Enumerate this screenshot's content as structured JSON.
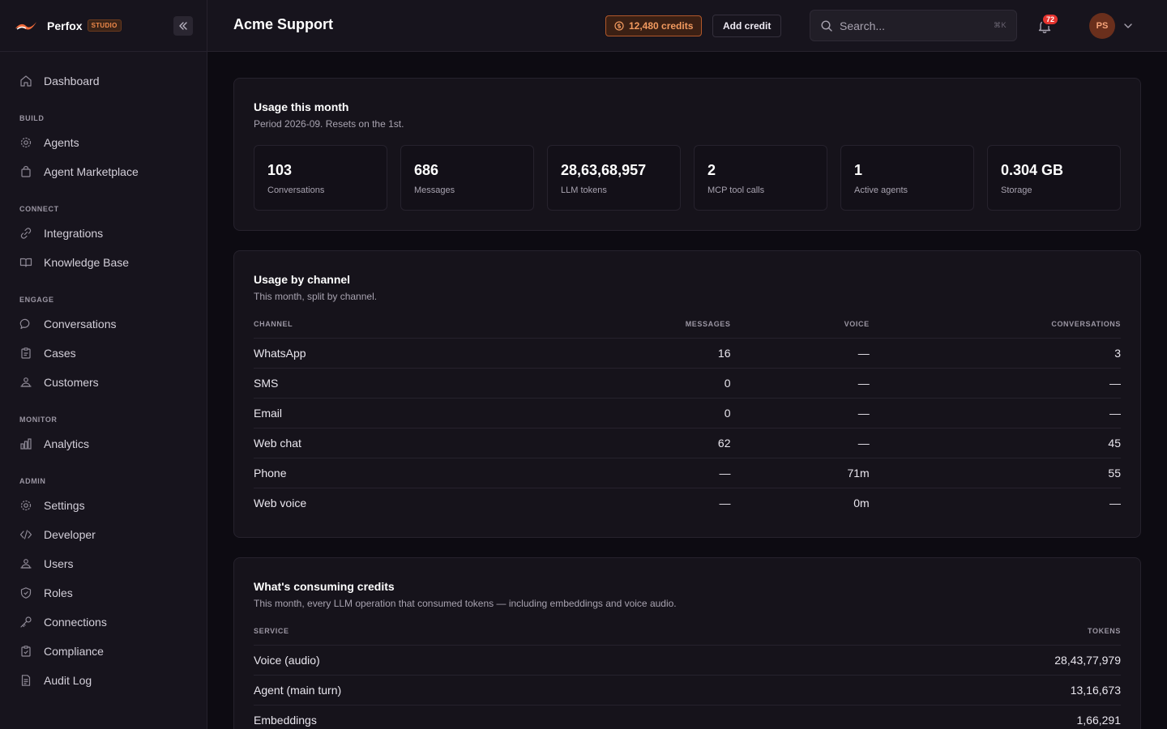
{
  "brand": {
    "name": "Perfox",
    "tag": "STUDIO",
    "accent": "#f08a4b"
  },
  "nav": {
    "dashboard": "Dashboard",
    "sections": {
      "build": "BUILD",
      "connect": "CONNECT",
      "engage": "ENGAGE",
      "monitor": "MONITOR",
      "admin": "ADMIN"
    },
    "items": {
      "agents": "Agents",
      "marketplace": "Agent Marketplace",
      "integrations": "Integrations",
      "knowledge": "Knowledge Base",
      "conversations": "Conversations",
      "cases": "Cases",
      "customers": "Customers",
      "analytics": "Analytics",
      "settings": "Settings",
      "developer": "Developer",
      "users": "Users",
      "roles": "Roles",
      "connections": "Connections",
      "compliance": "Compliance",
      "audit": "Audit Log"
    }
  },
  "header": {
    "title": "Acme Support",
    "credits": "12,480 credits",
    "add_credit": "Add credit",
    "search_placeholder": "Search...",
    "shortcut": "⌘K",
    "notifications": "72",
    "avatar": "PS"
  },
  "usage": {
    "title": "Usage this month",
    "subtitle": "Period 2026-09. Resets on the 1st.",
    "stats": [
      {
        "value": "103",
        "label": "Conversations"
      },
      {
        "value": "686",
        "label": "Messages"
      },
      {
        "value": "28,63,68,957",
        "label": "LLM tokens"
      },
      {
        "value": "2",
        "label": "MCP tool calls"
      },
      {
        "value": "1",
        "label": "Active agents"
      },
      {
        "value": "0.304 GB",
        "label": "Storage"
      }
    ]
  },
  "channels": {
    "title": "Usage by channel",
    "subtitle": "This month, split by channel.",
    "headers": {
      "channel": "CHANNEL",
      "messages": "MESSAGES",
      "voice": "VOICE",
      "conversations": "CONVERSATIONS"
    },
    "rows": [
      {
        "channel": "WhatsApp",
        "messages": "16",
        "voice": "—",
        "conversations": "3"
      },
      {
        "channel": "SMS",
        "messages": "0",
        "voice": "—",
        "conversations": "—"
      },
      {
        "channel": "Email",
        "messages": "0",
        "voice": "—",
        "conversations": "—"
      },
      {
        "channel": "Web chat",
        "messages": "62",
        "voice": "—",
        "conversations": "45"
      },
      {
        "channel": "Phone",
        "messages": "—",
        "voice": "71m",
        "conversations": "55"
      },
      {
        "channel": "Web voice",
        "messages": "—",
        "voice": "0m",
        "conversations": "—"
      }
    ]
  },
  "consuming": {
    "title": "What's consuming credits",
    "subtitle": "This month, every LLM operation that consumed tokens — including embeddings and voice audio.",
    "headers": {
      "service": "SERVICE",
      "tokens": "TOKENS"
    },
    "rows": [
      {
        "service": "Voice (audio)",
        "tokens": "28,43,77,979"
      },
      {
        "service": "Agent (main turn)",
        "tokens": "13,16,673"
      },
      {
        "service": "Embeddings",
        "tokens": "1,66,291"
      }
    ]
  }
}
